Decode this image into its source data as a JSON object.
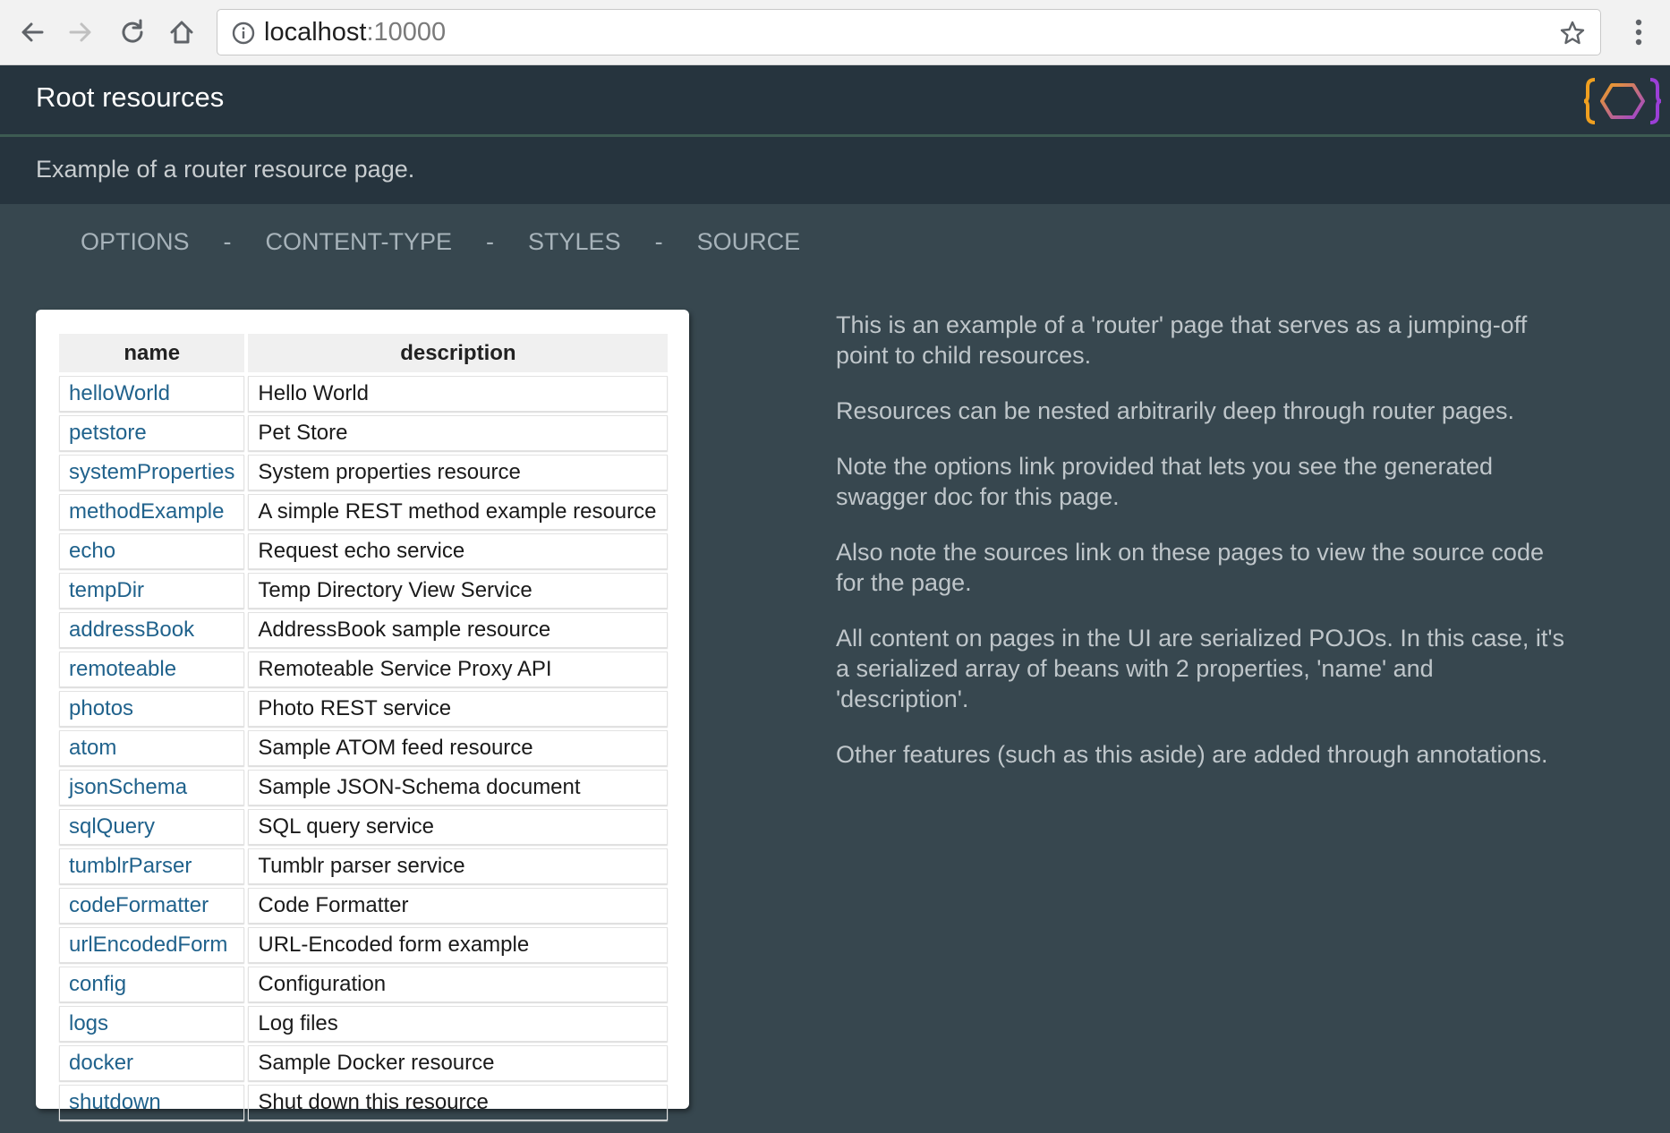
{
  "browser": {
    "url_host": "localhost",
    "url_port": ":10000",
    "buttons": [
      "back",
      "forward",
      "reload",
      "home"
    ]
  },
  "header": {
    "title": "Root resources",
    "subtitle": "Example of a router resource page."
  },
  "nav": {
    "links": [
      "OPTIONS",
      "CONTENT-TYPE",
      "STYLES",
      "SOURCE"
    ],
    "separator": "-"
  },
  "table": {
    "columns": [
      "name",
      "description"
    ],
    "rows": [
      {
        "name": "helloWorld",
        "description": "Hello World"
      },
      {
        "name": "petstore",
        "description": "Pet Store"
      },
      {
        "name": "systemProperties",
        "description": "System properties resource"
      },
      {
        "name": "methodExample",
        "description": "A simple REST method example resource"
      },
      {
        "name": "echo",
        "description": "Request echo service"
      },
      {
        "name": "tempDir",
        "description": "Temp Directory View Service"
      },
      {
        "name": "addressBook",
        "description": "AddressBook sample resource"
      },
      {
        "name": "remoteable",
        "description": "Remoteable Service Proxy API"
      },
      {
        "name": "photos",
        "description": "Photo REST service"
      },
      {
        "name": "atom",
        "description": "Sample ATOM feed resource"
      },
      {
        "name": "jsonSchema",
        "description": "Sample JSON-Schema document"
      },
      {
        "name": "sqlQuery",
        "description": "SQL query service"
      },
      {
        "name": "tumblrParser",
        "description": "Tumblr parser service"
      },
      {
        "name": "codeFormatter",
        "description": "Code Formatter"
      },
      {
        "name": "urlEncodedForm",
        "description": "URL-Encoded form example"
      },
      {
        "name": "config",
        "description": "Configuration"
      },
      {
        "name": "logs",
        "description": "Log files"
      },
      {
        "name": "docker",
        "description": "Sample Docker resource"
      },
      {
        "name": "shutdown",
        "description": "Shut down this resource"
      }
    ]
  },
  "aside": {
    "paragraphs": [
      "This is an example of a 'router' page that serves as a jumping-off point to child resources.",
      "Resources can be nested arbitrarily deep through router pages.",
      "Note the options link provided that lets you see the generated swagger doc for this page.",
      "Also note the sources link on these pages to view the source code for the page.",
      "All content on pages in the UI are serialized POJOs. In this case, it's a serialized array of beans with 2 properties, 'name' and 'description'.",
      "Other features (such as this aside) are added through annotations."
    ]
  },
  "colors": {
    "page_background": "#37474f",
    "header_background": "#26343e",
    "link": "#20628c",
    "nav_link": "#a7b3ba",
    "aside_text": "#bfc6ca",
    "logo_orange": "#f0a020",
    "logo_purple": "#9b3fd6"
  },
  "icons": [
    "back-arrow-icon",
    "forward-arrow-icon",
    "reload-icon",
    "home-icon",
    "info-icon",
    "bookmark-star-icon",
    "more-menu-icon",
    "juneau-logo"
  ]
}
